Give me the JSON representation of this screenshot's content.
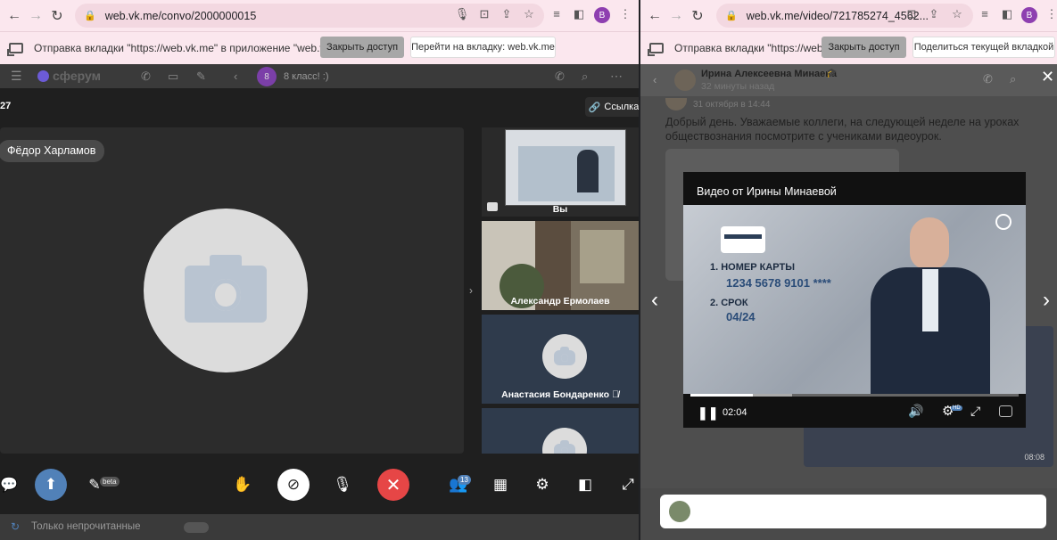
{
  "left": {
    "url": "web.vk.me/convo/2000000015",
    "avatar_letter": "B",
    "infobar": {
      "text": "Отправка вкладки \"https://web.vk.me\" в приложение \"web.vk.me\"...",
      "stop": "Закрыть доступ",
      "goto": "Перейти на вкладку: web.vk.me"
    },
    "brand": "сферум",
    "chat_badge": "8",
    "chat_title": "8 класс! :)",
    "call": {
      "count": "27",
      "link": "Ссылка",
      "speaker": "Фёдор Харламов",
      "tiles": [
        {
          "name": "Вы"
        },
        {
          "name": "Александр Ермолаев"
        },
        {
          "name": "Анастасия Бондаренко"
        },
        {
          "name": ""
        }
      ],
      "participants_count": "13",
      "beta": "beta"
    },
    "footer": {
      "unread": "Только непрочитанные"
    }
  },
  "right": {
    "url": "web.vk.me/video/721785274_4562...",
    "avatar_letter": "B",
    "infobar": {
      "text": "Отправка вкладки \"https://web....",
      "stop": "Закрыть доступ",
      "share": "Поделиться текущей вкладкой"
    },
    "sender": "Ирина Алексеевна Минаева",
    "time": "32 минуты назад",
    "date_line": "31 октября в 14:44",
    "message": "Добрый день. Уважаемые коллеги, на следующей неделе на уроках обществознания посмотрите с учениками видеоурок.",
    "thumb_time": "08:08",
    "player": {
      "title": "Видео от Ирины Минаевой",
      "current_time": "02:04",
      "progress": 0.19,
      "buffered": 0.31,
      "quality_badge": "HD",
      "slide": {
        "item1": "1. НОМЕР КАРТЫ",
        "item1_value": "1234 5678 9101 ****",
        "item2": "2. СРОК",
        "item2_value": "04/24"
      }
    }
  },
  "colors": {
    "accent": "#5181b8",
    "end_call": "#e64646",
    "infobar": "#fbe7ee"
  }
}
